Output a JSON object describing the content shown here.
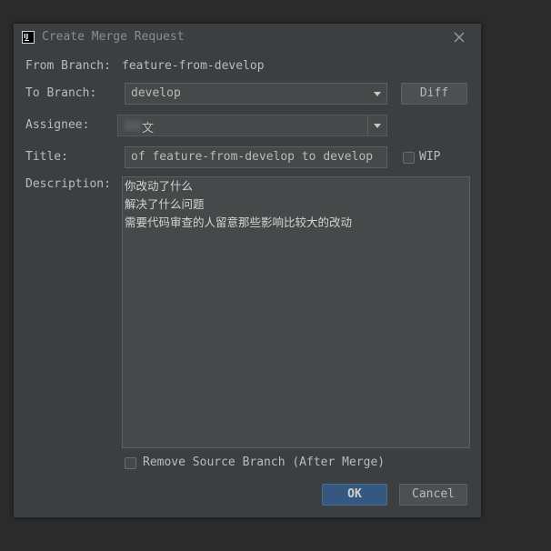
{
  "dialog": {
    "title": "Create Merge Request",
    "app_icon_text": "IJ",
    "icon": "intellij-app-icon",
    "close_icon": "close-icon"
  },
  "form": {
    "from_branch_label": "From Branch:",
    "from_branch_value": "feature-from-develop",
    "to_branch_label": "To Branch:",
    "to_branch_value": "develop",
    "diff_button": "Diff",
    "assignee_label": "Assignee:",
    "assignee_value": "文",
    "title_label": "Title:",
    "title_value": "of feature-from-develop to develop",
    "wip_label": "WIP",
    "wip_checked": false,
    "description_label": "Description:",
    "description_lines": [
      "你改动了什么",
      "解决了什么问题",
      "需要代码审查的人留意那些影响比较大的改动"
    ],
    "remove_source_label": "Remove Source Branch (After Merge)",
    "remove_source_checked": false
  },
  "buttons": {
    "ok": "OK",
    "cancel": "Cancel"
  },
  "colors": {
    "background": "#2b2b2b",
    "dialog": "#3c3f41",
    "field": "#45494a",
    "primary": "#365880",
    "text": "#bbbbbb"
  }
}
